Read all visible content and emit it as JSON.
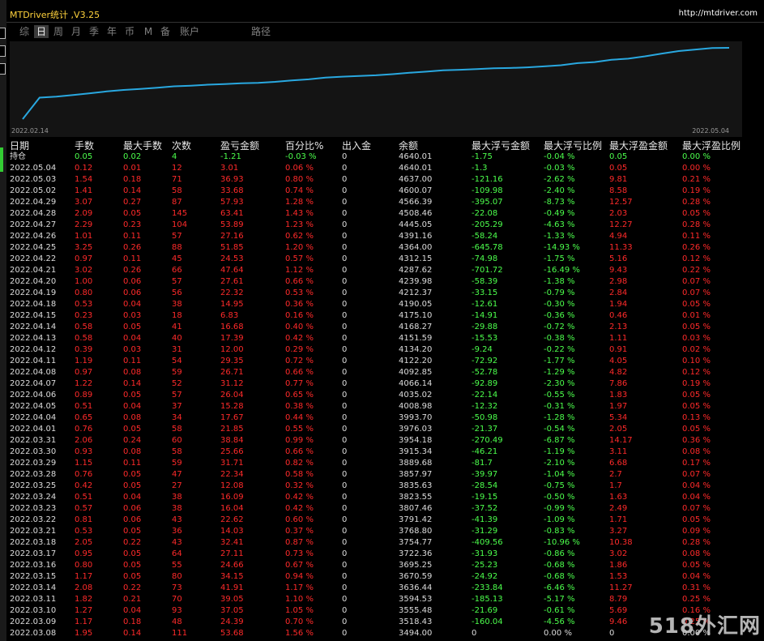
{
  "window": {
    "title": "MTDriver统计 ,V3.25",
    "url": "http://mtdriver.com"
  },
  "tabs": [
    {
      "label": "综",
      "active": false
    },
    {
      "label": "日",
      "active": true
    },
    {
      "label": "周",
      "active": false
    },
    {
      "label": "月",
      "active": false
    },
    {
      "label": "季",
      "active": false
    },
    {
      "label": "年",
      "active": false
    },
    {
      "label": "币",
      "active": false
    },
    {
      "label": "M",
      "active": false
    },
    {
      "label": "备",
      "active": false
    },
    {
      "label": "账户",
      "active": false
    },
    {
      "label": "路径",
      "active": false
    }
  ],
  "chart": {
    "start_label": "2022.02.14",
    "end_label": "2022.05.04",
    "line_color": "#29a8e0"
  },
  "chart_data": {
    "type": "line",
    "x": [
      "2022.02.14",
      "2022.03.08",
      "2022.03.09",
      "2022.03.10",
      "2022.03.11",
      "2022.03.14",
      "2022.03.15",
      "2022.03.16",
      "2022.03.17",
      "2022.03.18",
      "2022.03.21",
      "2022.03.22",
      "2022.03.23",
      "2022.03.24",
      "2022.03.25",
      "2022.03.28",
      "2022.03.29",
      "2022.03.30",
      "2022.03.31",
      "2022.04.01",
      "2022.04.04",
      "2022.04.05",
      "2022.04.06",
      "2022.04.07",
      "2022.04.08",
      "2022.04.11",
      "2022.04.12",
      "2022.04.13",
      "2022.04.14",
      "2022.04.15",
      "2022.04.18",
      "2022.04.19",
      "2022.04.20",
      "2022.04.21",
      "2022.04.22",
      "2022.04.25",
      "2022.04.26",
      "2022.04.27",
      "2022.04.28",
      "2022.04.29",
      "2022.05.02",
      "2022.05.03",
      "2022.05.04"
    ],
    "values": [
      3000,
      3494.0,
      3518.43,
      3555.48,
      3594.53,
      3636.44,
      3670.59,
      3695.25,
      3722.36,
      3754.77,
      3768.8,
      3791.42,
      3807.46,
      3823.55,
      3835.63,
      3857.97,
      3889.68,
      3915.34,
      3954.18,
      3976.03,
      3993.7,
      4008.98,
      4035.02,
      4066.14,
      4092.85,
      4122.2,
      4134.2,
      4151.59,
      4168.27,
      4175.1,
      4190.05,
      4212.37,
      4239.98,
      4287.62,
      4312.15,
      4364.0,
      4391.16,
      4445.05,
      4508.46,
      4566.39,
      4600.07,
      4637.0,
      4640.01
    ],
    "color": "#29a8e0"
  },
  "table": {
    "headers": [
      "日期",
      "手数",
      "最大手数",
      "次数",
      "盈亏金额",
      "百分比%",
      "出入金",
      "余额",
      "最大浮亏金额",
      "最大浮亏比例",
      "最大浮盈金额",
      "最大浮盈比例"
    ],
    "holding": [
      "持仓",
      "0.05",
      "0.02",
      "4",
      "-1.21",
      "-0.03 %",
      "0",
      "4640.01",
      "-1.75",
      "-0.04 %",
      "0.05",
      "0.00 %"
    ],
    "rows": [
      [
        "2022.05.04",
        "0.12",
        "0.01",
        "12",
        "3.01",
        "0.06 %",
        "0",
        "4640.01",
        "-1.3",
        "-0.03 %",
        "0.05",
        "0.00 %"
      ],
      [
        "2022.05.03",
        "1.54",
        "0.18",
        "71",
        "36.93",
        "0.80 %",
        "0",
        "4637.00",
        "-121.16",
        "-2.62 %",
        "9.81",
        "0.21 %"
      ],
      [
        "2022.05.02",
        "1.41",
        "0.14",
        "58",
        "33.68",
        "0.74 %",
        "0",
        "4600.07",
        "-109.98",
        "-2.40 %",
        "8.58",
        "0.19 %"
      ],
      [
        "2022.04.29",
        "3.07",
        "0.27",
        "87",
        "57.93",
        "1.28 %",
        "0",
        "4566.39",
        "-395.07",
        "-8.73 %",
        "12.57",
        "0.28 %"
      ],
      [
        "2022.04.28",
        "2.09",
        "0.05",
        "145",
        "63.41",
        "1.43 %",
        "0",
        "4508.46",
        "-22.08",
        "-0.49 %",
        "2.03",
        "0.05 %"
      ],
      [
        "2022.04.27",
        "2.29",
        "0.23",
        "104",
        "53.89",
        "1.23 %",
        "0",
        "4445.05",
        "-205.29",
        "-4.63 %",
        "12.27",
        "0.28 %"
      ],
      [
        "2022.04.26",
        "1.01",
        "0.11",
        "57",
        "27.16",
        "0.62 %",
        "0",
        "4391.16",
        "-58.24",
        "-1.33 %",
        "4.94",
        "0.11 %"
      ],
      [
        "2022.04.25",
        "3.25",
        "0.26",
        "88",
        "51.85",
        "1.20 %",
        "0",
        "4364.00",
        "-645.78",
        "-14.93 %",
        "11.33",
        "0.26 %"
      ],
      [
        "2022.04.22",
        "0.97",
        "0.11",
        "45",
        "24.53",
        "0.57 %",
        "0",
        "4312.15",
        "-74.98",
        "-1.75 %",
        "5.16",
        "0.12 %"
      ],
      [
        "2022.04.21",
        "3.02",
        "0.26",
        "66",
        "47.64",
        "1.12 %",
        "0",
        "4287.62",
        "-701.72",
        "-16.49 %",
        "9.43",
        "0.22 %"
      ],
      [
        "2022.04.20",
        "1.00",
        "0.06",
        "57",
        "27.61",
        "0.66 %",
        "0",
        "4239.98",
        "-58.39",
        "-1.38 %",
        "2.98",
        "0.07 %"
      ],
      [
        "2022.04.19",
        "0.80",
        "0.06",
        "56",
        "22.32",
        "0.53 %",
        "0",
        "4212.37",
        "-33.15",
        "-0.79 %",
        "2.84",
        "0.07 %"
      ],
      [
        "2022.04.18",
        "0.53",
        "0.04",
        "38",
        "14.95",
        "0.36 %",
        "0",
        "4190.05",
        "-12.61",
        "-0.30 %",
        "1.94",
        "0.05 %"
      ],
      [
        "2022.04.15",
        "0.23",
        "0.03",
        "18",
        "6.83",
        "0.16 %",
        "0",
        "4175.10",
        "-14.91",
        "-0.36 %",
        "0.46",
        "0.01 %"
      ],
      [
        "2022.04.14",
        "0.58",
        "0.05",
        "41",
        "16.68",
        "0.40 %",
        "0",
        "4168.27",
        "-29.88",
        "-0.72 %",
        "2.13",
        "0.05 %"
      ],
      [
        "2022.04.13",
        "0.58",
        "0.04",
        "40",
        "17.39",
        "0.42 %",
        "0",
        "4151.59",
        "-15.53",
        "-0.38 %",
        "1.11",
        "0.03 %"
      ],
      [
        "2022.04.12",
        "0.39",
        "0.03",
        "31",
        "12.00",
        "0.29 %",
        "0",
        "4134.20",
        "-9.24",
        "-0.22 %",
        "0.91",
        "0.02 %"
      ],
      [
        "2022.04.11",
        "1.19",
        "0.11",
        "54",
        "29.35",
        "0.72 %",
        "0",
        "4122.20",
        "-72.92",
        "-1.77 %",
        "4.05",
        "0.10 %"
      ],
      [
        "2022.04.08",
        "0.97",
        "0.08",
        "59",
        "26.71",
        "0.66 %",
        "0",
        "4092.85",
        "-52.78",
        "-1.29 %",
        "4.82",
        "0.12 %"
      ],
      [
        "2022.04.07",
        "1.22",
        "0.14",
        "52",
        "31.12",
        "0.77 %",
        "0",
        "4066.14",
        "-92.89",
        "-2.30 %",
        "7.86",
        "0.19 %"
      ],
      [
        "2022.04.06",
        "0.89",
        "0.05",
        "57",
        "26.04",
        "0.65 %",
        "0",
        "4035.02",
        "-22.14",
        "-0.55 %",
        "1.83",
        "0.05 %"
      ],
      [
        "2022.04.05",
        "0.51",
        "0.04",
        "37",
        "15.28",
        "0.38 %",
        "0",
        "4008.98",
        "-12.32",
        "-0.31 %",
        "1.97",
        "0.05 %"
      ],
      [
        "2022.04.04",
        "0.65",
        "0.08",
        "34",
        "17.67",
        "0.44 %",
        "0",
        "3993.70",
        "-50.98",
        "-1.28 %",
        "5.34",
        "0.13 %"
      ],
      [
        "2022.04.01",
        "0.76",
        "0.05",
        "58",
        "21.85",
        "0.55 %",
        "0",
        "3976.03",
        "-21.37",
        "-0.54 %",
        "2.05",
        "0.05 %"
      ],
      [
        "2022.03.31",
        "2.06",
        "0.24",
        "60",
        "38.84",
        "0.99 %",
        "0",
        "3954.18",
        "-270.49",
        "-6.87 %",
        "14.17",
        "0.36 %"
      ],
      [
        "2022.03.30",
        "0.93",
        "0.08",
        "58",
        "25.66",
        "0.66 %",
        "0",
        "3915.34",
        "-46.21",
        "-1.19 %",
        "3.11",
        "0.08 %"
      ],
      [
        "2022.03.29",
        "1.15",
        "0.11",
        "59",
        "31.71",
        "0.82 %",
        "0",
        "3889.68",
        "-81.7",
        "-2.10 %",
        "6.68",
        "0.17 %"
      ],
      [
        "2022.03.28",
        "0.76",
        "0.05",
        "47",
        "22.34",
        "0.58 %",
        "0",
        "3857.97",
        "-39.97",
        "-1.04 %",
        "2.7",
        "0.07 %"
      ],
      [
        "2022.03.25",
        "0.42",
        "0.05",
        "27",
        "12.08",
        "0.32 %",
        "0",
        "3835.63",
        "-28.54",
        "-0.75 %",
        "1.7",
        "0.04 %"
      ],
      [
        "2022.03.24",
        "0.51",
        "0.04",
        "38",
        "16.09",
        "0.42 %",
        "0",
        "3823.55",
        "-19.15",
        "-0.50 %",
        "1.63",
        "0.04 %"
      ],
      [
        "2022.03.23",
        "0.57",
        "0.06",
        "38",
        "16.04",
        "0.42 %",
        "0",
        "3807.46",
        "-37.52",
        "-0.99 %",
        "2.49",
        "0.07 %"
      ],
      [
        "2022.03.22",
        "0.81",
        "0.06",
        "43",
        "22.62",
        "0.60 %",
        "0",
        "3791.42",
        "-41.39",
        "-1.09 %",
        "1.71",
        "0.05 %"
      ],
      [
        "2022.03.21",
        "0.53",
        "0.05",
        "36",
        "14.03",
        "0.37 %",
        "0",
        "3768.80",
        "-31.29",
        "-0.83 %",
        "3.27",
        "0.09 %"
      ],
      [
        "2022.03.18",
        "2.05",
        "0.22",
        "43",
        "32.41",
        "0.87 %",
        "0",
        "3754.77",
        "-409.56",
        "-10.96 %",
        "10.38",
        "0.28 %"
      ],
      [
        "2022.03.17",
        "0.95",
        "0.05",
        "64",
        "27.11",
        "0.73 %",
        "0",
        "3722.36",
        "-31.93",
        "-0.86 %",
        "3.02",
        "0.08 %"
      ],
      [
        "2022.03.16",
        "0.80",
        "0.05",
        "55",
        "24.66",
        "0.67 %",
        "0",
        "3695.25",
        "-25.23",
        "-0.68 %",
        "1.86",
        "0.05 %"
      ],
      [
        "2022.03.15",
        "1.17",
        "0.05",
        "80",
        "34.15",
        "0.94 %",
        "0",
        "3670.59",
        "-24.92",
        "-0.68 %",
        "1.53",
        "0.04 %"
      ],
      [
        "2022.03.14",
        "2.08",
        "0.22",
        "73",
        "41.91",
        "1.17 %",
        "0",
        "3636.44",
        "-233.84",
        "-6.46 %",
        "11.27",
        "0.31 %"
      ],
      [
        "2022.03.11",
        "1.82",
        "0.21",
        "70",
        "39.05",
        "1.10 %",
        "0",
        "3594.53",
        "-185.13",
        "-5.17 %",
        "8.79",
        "0.25 %"
      ],
      [
        "2022.03.10",
        "1.27",
        "0.04",
        "93",
        "37.05",
        "1.05 %",
        "0",
        "3555.48",
        "-21.69",
        "-0.61 %",
        "5.69",
        "0.16 %"
      ],
      [
        "2022.03.09",
        "1.17",
        "0.18",
        "48",
        "24.39",
        "0.70 %",
        "0",
        "3518.43",
        "-160.04",
        "-4.56 %",
        "9.46",
        "0.25 %"
      ],
      [
        "2022.03.08",
        "1.95",
        "0.14",
        "111",
        "53.68",
        "1.56 %",
        "0",
        "3494.00",
        "0",
        "0.00 %",
        "0",
        "0.00 %"
      ]
    ]
  },
  "watermark": "518外汇网"
}
